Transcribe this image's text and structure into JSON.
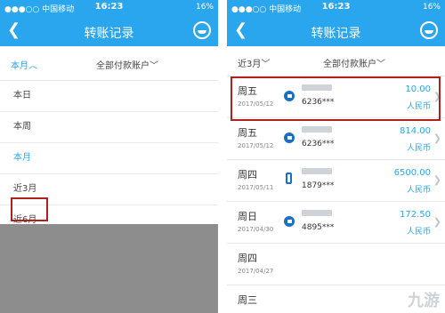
{
  "status_bar": {
    "carrier": "●●●○○ 中国移动",
    "time": "16:23",
    "battery": "16%"
  },
  "left": {
    "title": "转账记录",
    "filter_period": "本月︿",
    "filter_account": "全部付款账户﹀",
    "menu": [
      "本日",
      "本周",
      "本月",
      "近3月",
      "近6月"
    ],
    "selected": "本月"
  },
  "right": {
    "title": "转账记录",
    "filter_period": "近3月﹀",
    "filter_account": "全部付款账户﹀",
    "records": [
      {
        "day": "周五",
        "date": "2017/05/12",
        "account": "6236***",
        "amount": "10.00",
        "currency": "人民币",
        "icon": "bank-icon"
      },
      {
        "day": "周五",
        "date": "2017/05/12",
        "account": "6236***",
        "amount": "814.00",
        "currency": "人民币",
        "icon": "bank-icon"
      },
      {
        "day": "周四",
        "date": "2017/05/11",
        "account": "1879***",
        "amount": "6500.00",
        "currency": "人民币",
        "icon": "phone-icon"
      },
      {
        "day": "周日",
        "date": "2017/04/30",
        "account": "4895***",
        "amount": "172.50",
        "currency": "人民币",
        "icon": "bank-icon"
      },
      {
        "day": "周四",
        "date": "2017/04/27",
        "account": "",
        "amount": "",
        "currency": "",
        "icon": ""
      },
      {
        "day": "周三",
        "date": "",
        "account": "",
        "amount": "",
        "currency": "",
        "icon": ""
      }
    ]
  },
  "watermark": "九游",
  "colors": {
    "accent": "#2aa6ee",
    "highlight": "#b0201f"
  }
}
